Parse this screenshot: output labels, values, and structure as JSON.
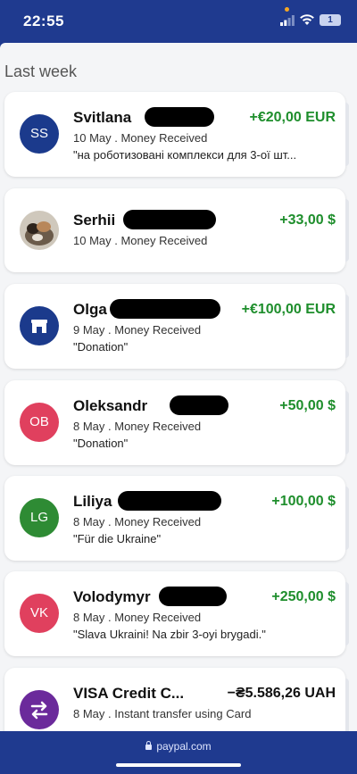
{
  "status": {
    "time": "22:55",
    "battery": "1"
  },
  "section": {
    "title": "Last week"
  },
  "transactions": [
    {
      "initials": "SS",
      "avatar_color": "#1b3a8c",
      "name": "Svitlana",
      "amount": "+€20,00 EUR",
      "date_type": "10 May . Money Received",
      "note": "\"на роботизовані комплекси для 3-ої шт..."
    },
    {
      "initials": "",
      "avatar_color": "#8a7f72",
      "name": "Serhii",
      "amount": "+33,00 $",
      "date_type": "10 May . Money Received",
      "note": ""
    },
    {
      "initials": "",
      "avatar_color": "#1b3a8c",
      "icon": "store-icon",
      "name": "Olga",
      "amount": "+€100,00 EUR",
      "date_type": "9 May . Money Received",
      "note": "\"Donation\""
    },
    {
      "initials": "OB",
      "avatar_color": "#e0405e",
      "name": "Oleksandr",
      "amount": "+50,00 $",
      "date_type": "8 May . Money Received",
      "note": "\"Donation\""
    },
    {
      "initials": "LG",
      "avatar_color": "#2e8b34",
      "name": "Liliya",
      "amount": "+100,00 $",
      "date_type": "8 May . Money Received",
      "note": "\"Für die Ukraine\""
    },
    {
      "initials": "VK",
      "avatar_color": "#e0405e",
      "name": "Volodymyr",
      "amount": "+250,00 $",
      "date_type": "8 May . Money Received",
      "note": "\"Slava Ukraini! Na zbir 3-oyi brygadi.\""
    },
    {
      "initials": "",
      "avatar_color": "#6b2a9b",
      "icon": "transfer-icon",
      "name": "VISA Credit C...",
      "amount": "−₴5.586,26 UAH",
      "date_type": "8 May . Instant transfer using Card",
      "note": ""
    }
  ],
  "footer": {
    "url": "paypal.com"
  }
}
